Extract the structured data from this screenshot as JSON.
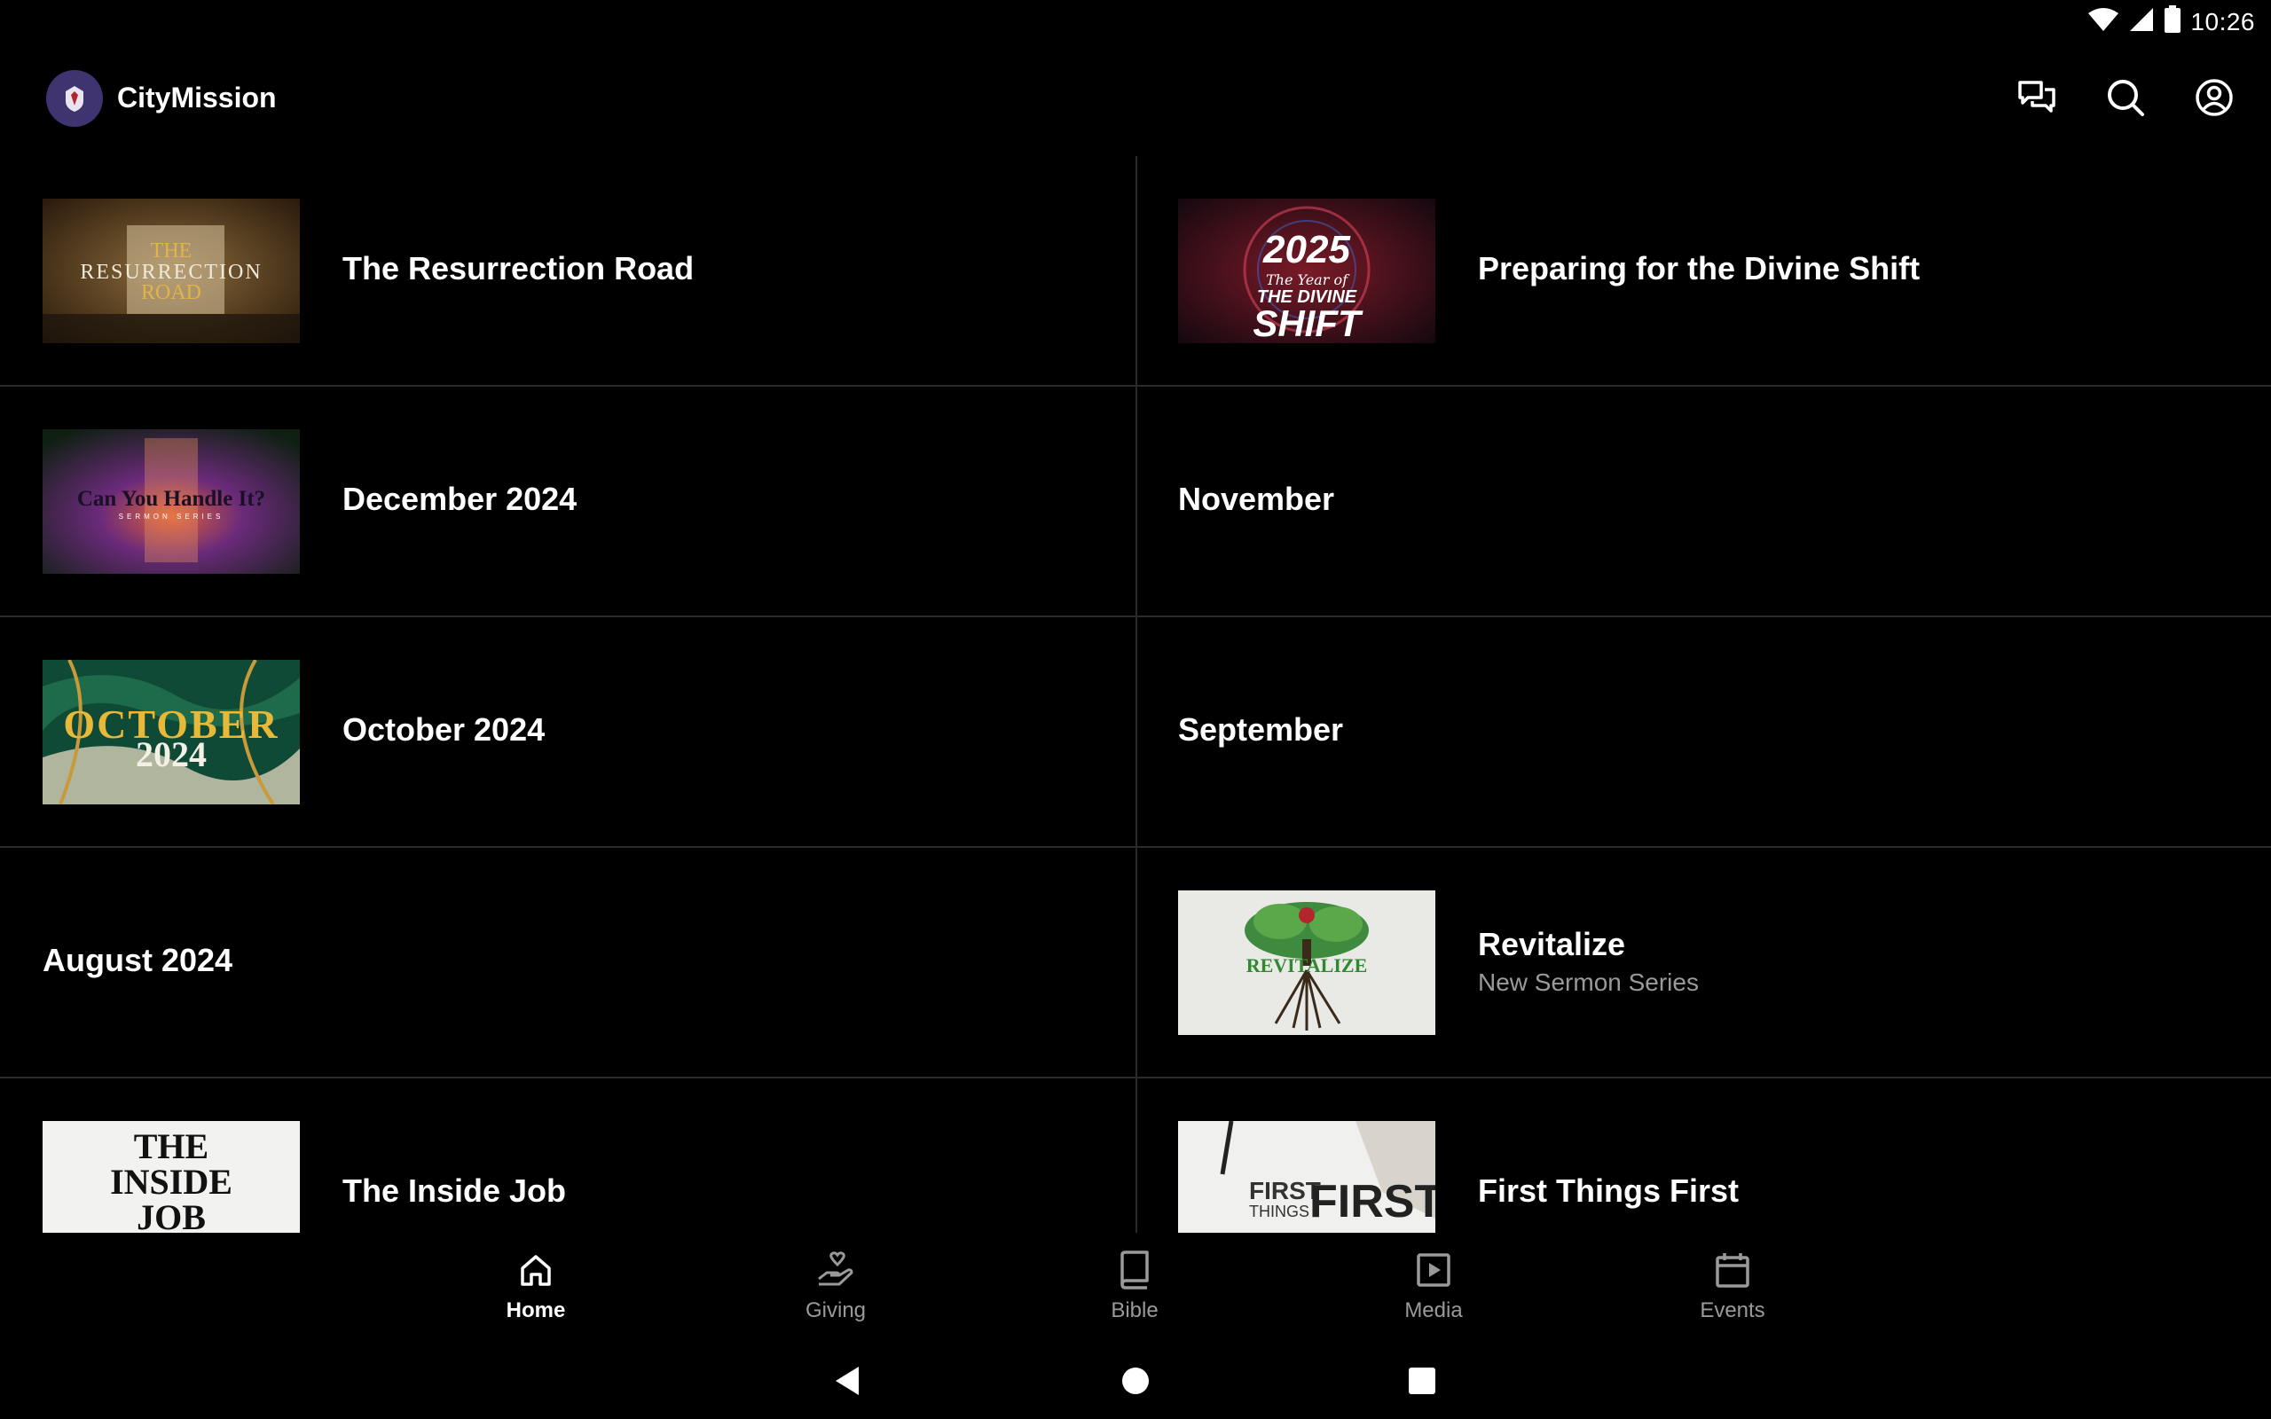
{
  "status_bar": {
    "time": "10:26",
    "icons": [
      "wifi-icon",
      "cell-signal-icon",
      "battery-icon"
    ]
  },
  "app_bar": {
    "title": "CityMission",
    "actions": [
      "chat-icon",
      "search-icon",
      "account-icon"
    ]
  },
  "items": [
    {
      "title": "The Resurrection Road",
      "thumb_text": [
        "THE",
        "RESURRECTION",
        "ROAD"
      ]
    },
    {
      "title": "Preparing for the Divine Shift",
      "thumb_text": [
        "2025",
        "The Year of",
        "THE DIVINE",
        "SHIFT"
      ]
    },
    {
      "title": "December 2024",
      "thumb_text": [
        "Can You Handle It?",
        "SERMON SERIES"
      ]
    },
    {
      "title": "November"
    },
    {
      "title": "October 2024",
      "thumb_text": [
        "OCTOBER",
        "2024"
      ]
    },
    {
      "title": "September"
    },
    {
      "title": "August 2024"
    },
    {
      "title": "Revitalize",
      "subtitle": "New Sermon Series",
      "thumb_text": [
        "REVITALIZE"
      ]
    },
    {
      "title": "The Inside Job",
      "thumb_text": [
        "THE",
        "INSIDE",
        "JOB"
      ]
    },
    {
      "title": "First Things First",
      "thumb_text": [
        "FIRST",
        "THINGS",
        "FIRST"
      ]
    }
  ],
  "bottom_nav": [
    {
      "label": "Home",
      "icon": "home-icon",
      "active": true
    },
    {
      "label": "Giving",
      "icon": "giving-icon",
      "active": false
    },
    {
      "label": "Bible",
      "icon": "bible-icon",
      "active": false
    },
    {
      "label": "Media",
      "icon": "media-icon",
      "active": false
    },
    {
      "label": "Events",
      "icon": "calendar-icon",
      "active": false
    }
  ],
  "colors": {
    "background": "#000000",
    "divider": "#2a2a2a",
    "subtitle": "#9a9a9a",
    "logo_bg": "#3f3370"
  }
}
